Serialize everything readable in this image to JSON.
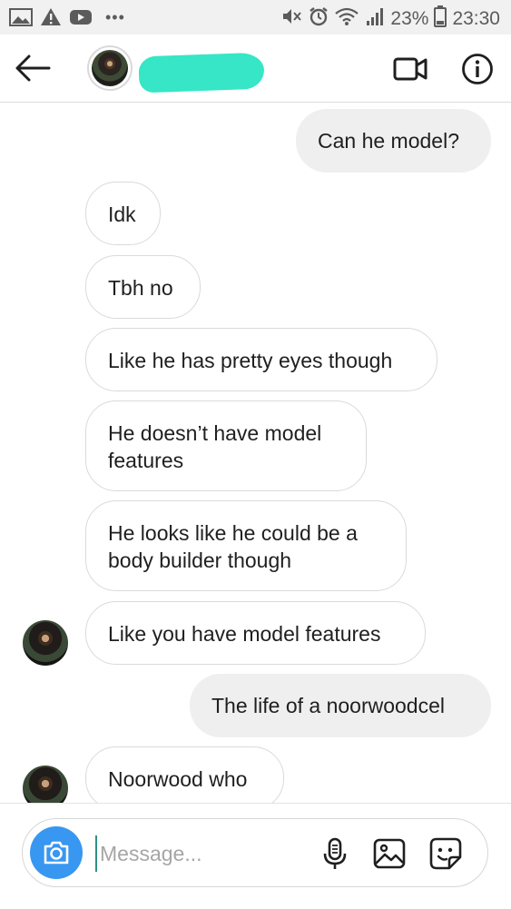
{
  "status_bar": {
    "battery_percent": "23%",
    "time": "23:30",
    "icons": [
      "gallery-icon",
      "warning-icon",
      "youtube-icon",
      "more-dots-icon",
      "mute-icon",
      "alarm-icon",
      "wifi-icon",
      "signal-icon",
      "battery-icon"
    ]
  },
  "header": {
    "icons": [
      "back-arrow-icon",
      "video-call-icon",
      "info-icon"
    ],
    "name_redaction_color": "#36e6c6"
  },
  "messages": [
    {
      "id": "m1",
      "direction": "outgoing",
      "text": "Can he model?"
    },
    {
      "id": "m2",
      "direction": "incoming",
      "text": "Idk"
    },
    {
      "id": "m3",
      "direction": "incoming",
      "text": "Tbh no"
    },
    {
      "id": "m4",
      "direction": "incoming",
      "text": "Like he has pretty eyes though"
    },
    {
      "id": "m5",
      "direction": "incoming",
      "text": "He doesn’t have model features"
    },
    {
      "id": "m6",
      "direction": "incoming",
      "text": "He looks like he could be a body builder though"
    },
    {
      "id": "m7",
      "direction": "incoming",
      "text": "Like you have model features"
    },
    {
      "id": "m8",
      "direction": "outgoing",
      "text": "The life of a noorwoodcel"
    },
    {
      "id": "m9",
      "direction": "incoming",
      "text": "Noorwood who"
    }
  ],
  "composer": {
    "placeholder": "Message...",
    "value": "",
    "icons": [
      "camera-icon",
      "microphone-icon",
      "gallery-icon",
      "sticker-icon"
    ],
    "accent_color": "#3897f0"
  }
}
